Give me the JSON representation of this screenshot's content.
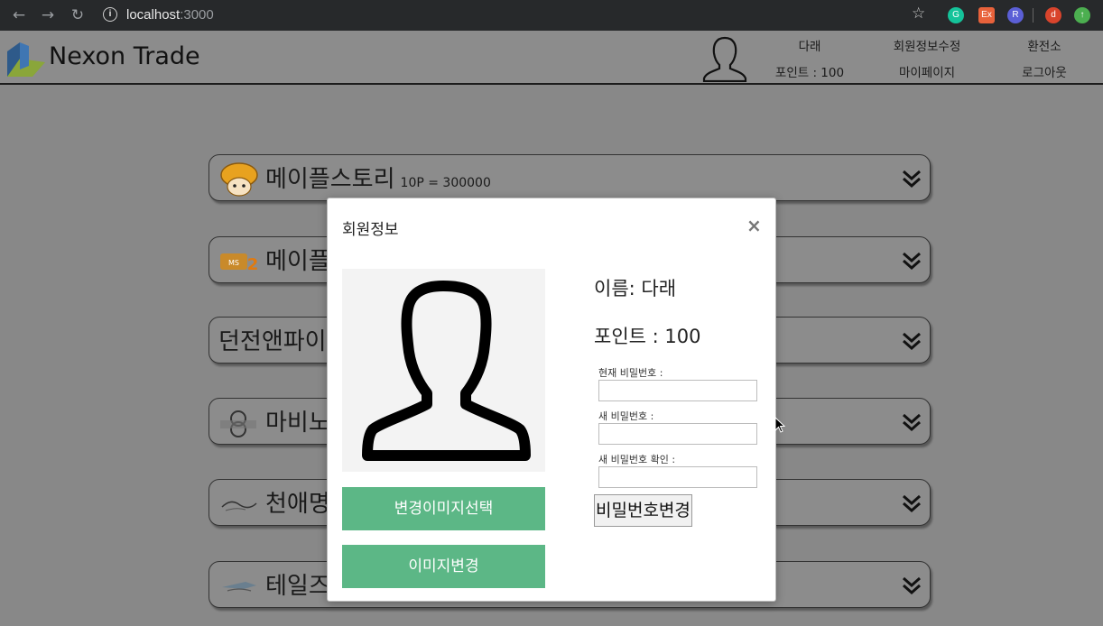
{
  "browser": {
    "url_host": "localhost",
    "url_port": ":3000",
    "extensions": [
      {
        "name": "grammarly-icon",
        "glyph": "G",
        "color": "#15c39a"
      },
      {
        "name": "extension-ex-icon",
        "glyph": "Ex",
        "color": "#e8623b"
      },
      {
        "name": "extension-r-icon",
        "glyph": "R",
        "color": "#5b5fd6"
      },
      {
        "name": "profile-avatar",
        "glyph": "d",
        "color": "#d9442c"
      },
      {
        "name": "update-icon",
        "glyph": "↑",
        "color": "#4caf50"
      }
    ]
  },
  "header": {
    "brand": "Nexon Trade",
    "user_name": "다래",
    "points": "포인트 : 100",
    "edit_info": "회원정보수정",
    "mypage": "마이페이지",
    "exchange": "환전소",
    "logout": "로그아웃"
  },
  "games": [
    {
      "name": "메이플스토리",
      "rate": "10P = 300000",
      "icon": "maplestory-mushroom-icon"
    },
    {
      "name": "메이플",
      "rate": "",
      "icon": "maplestory2-logo-icon"
    },
    {
      "name": "던전앤파이",
      "rate": "",
      "icon": ""
    },
    {
      "name": "마비노",
      "rate": "",
      "icon": "mabinogi-logo-icon"
    },
    {
      "name": "천애명",
      "rate": "",
      "icon": "game-logo-icon"
    },
    {
      "name": "테일즈",
      "rate": "",
      "icon": "game-logo-icon"
    }
  ],
  "modal": {
    "title": "회원정보",
    "close": "×",
    "select_image": "변경이미지선택",
    "change_image": "이미지변경",
    "name_line": "이름: 다래",
    "points_line": "포인트 : 100",
    "current_pw_label": "현재 비밀번호 :",
    "new_pw_label": "새 비밀번호 :",
    "confirm_pw_label": "새 비밀번호 확인 :",
    "change_pw_button": "비밀번호변경",
    "current_pw_value": "",
    "new_pw_value": "",
    "confirm_pw_value": ""
  },
  "colors": {
    "accent_green": "#5cb786",
    "overlay_gray": "#888888"
  }
}
